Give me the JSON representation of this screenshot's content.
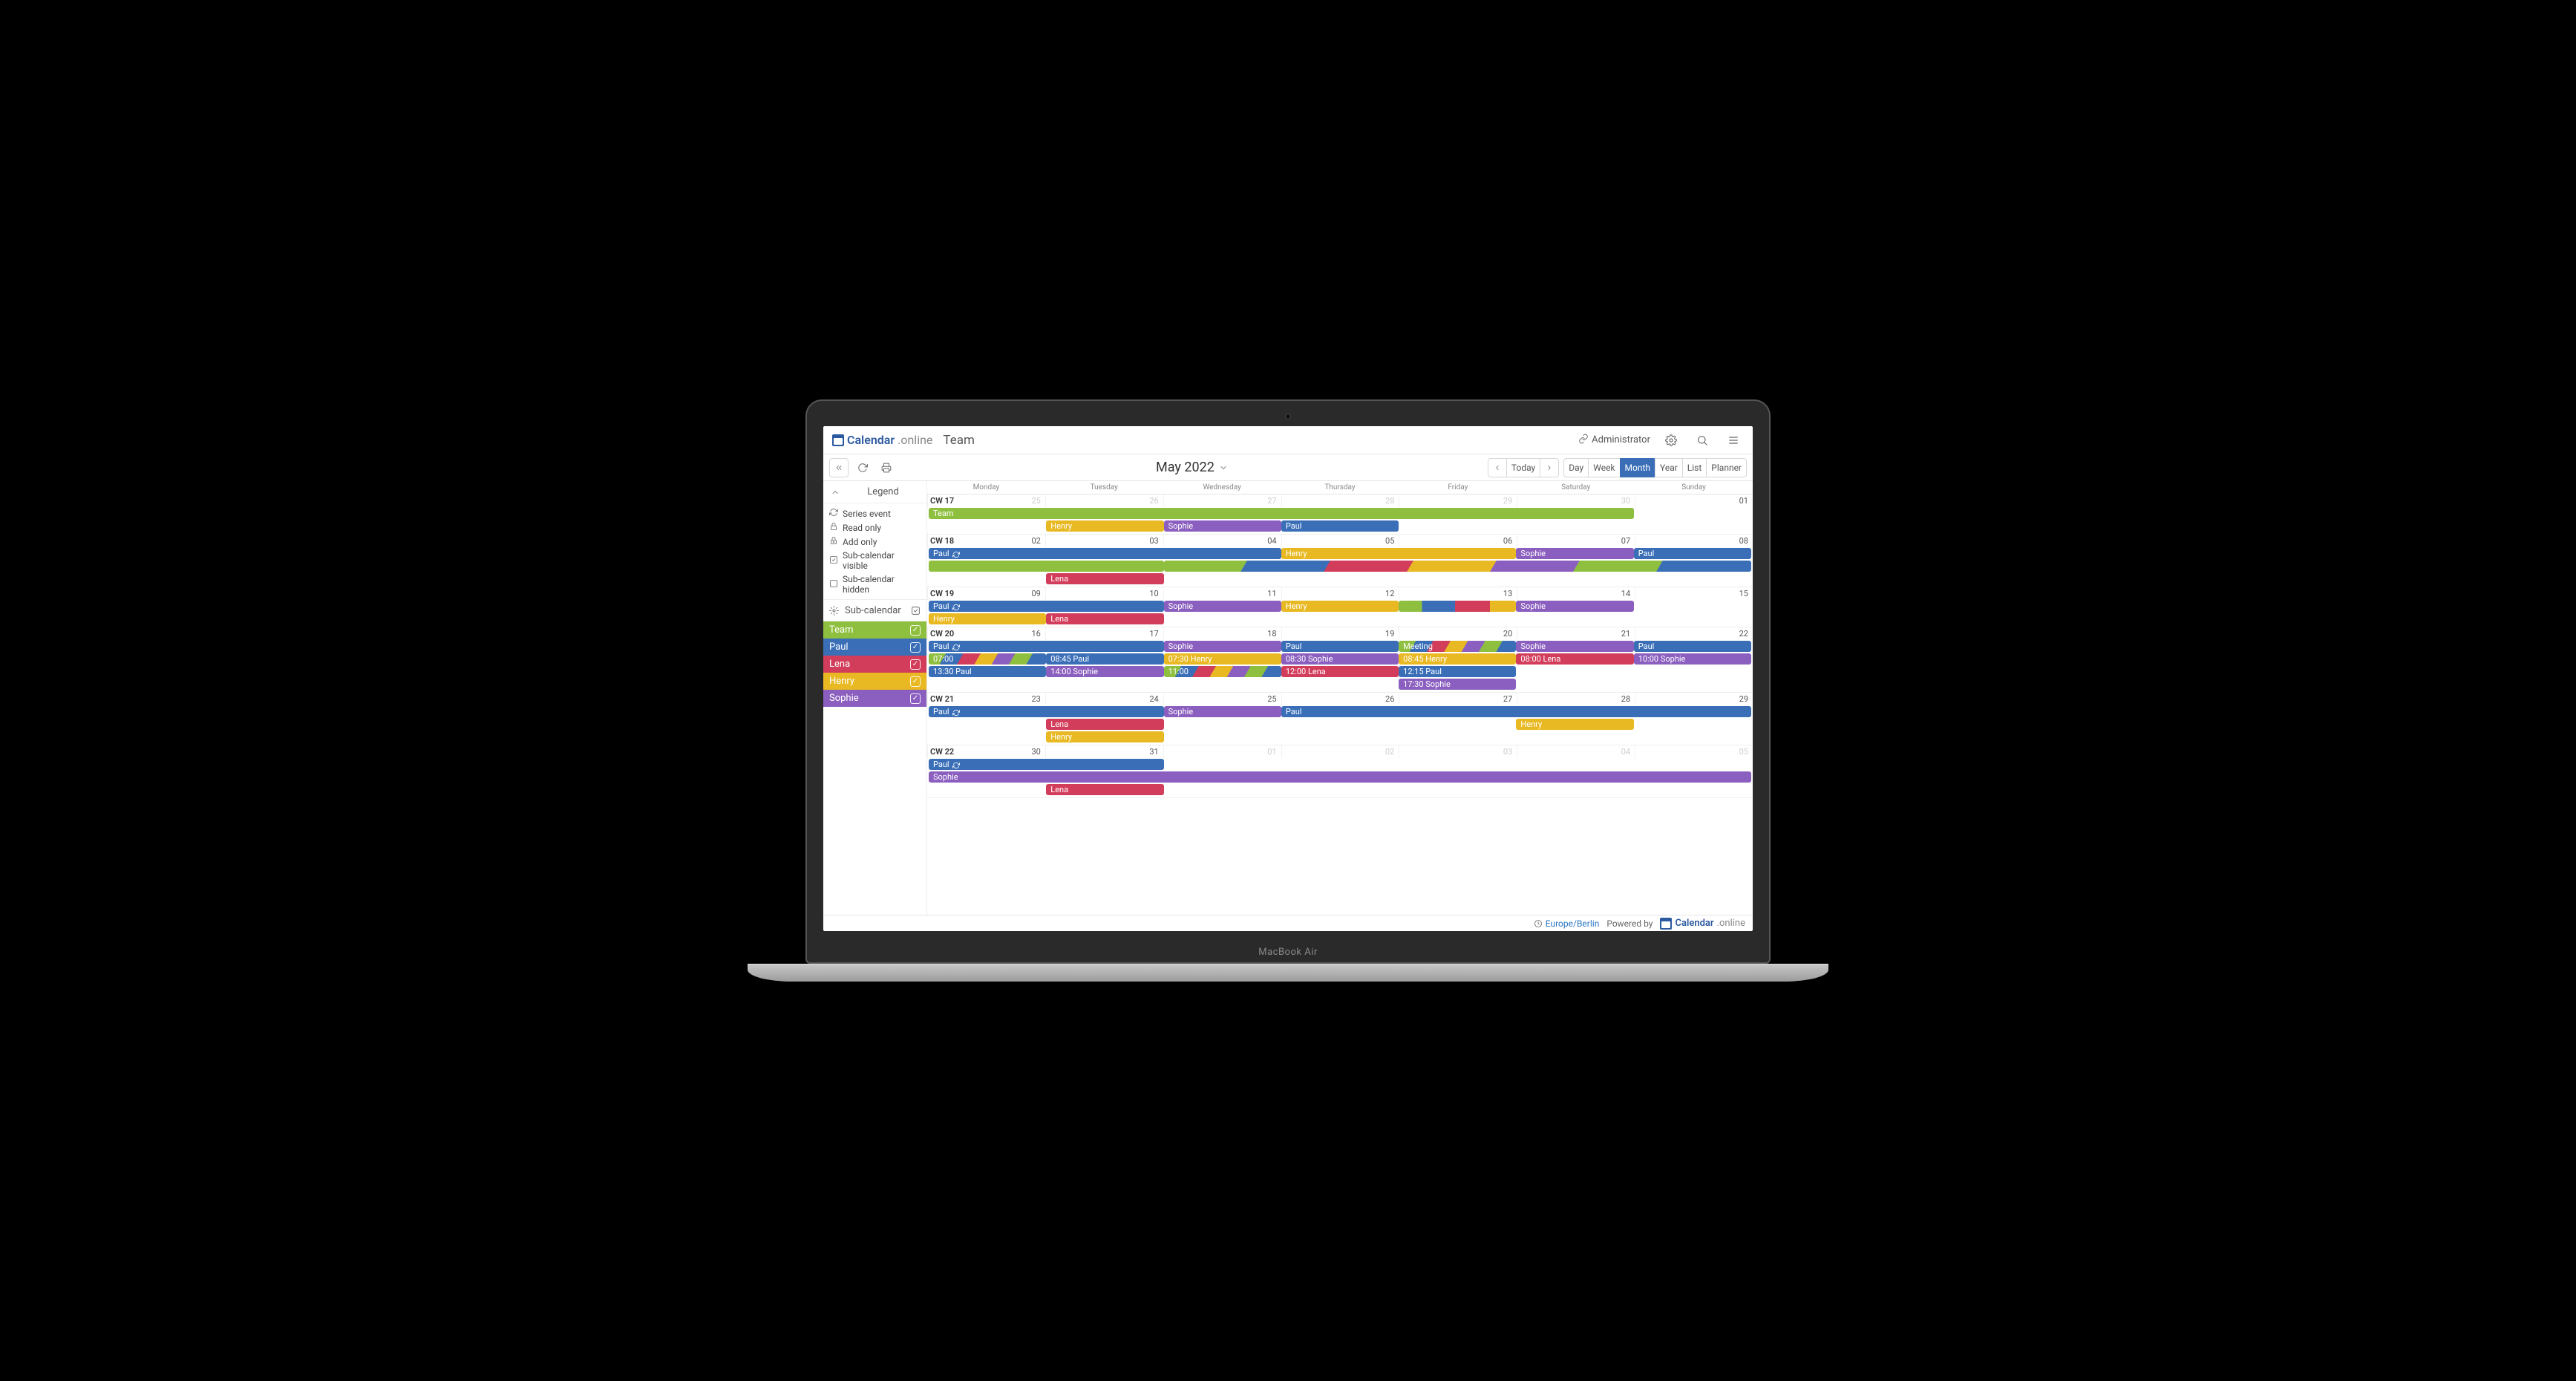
{
  "brand": {
    "part1": "Calendar",
    "part2": ".online"
  },
  "calendar_name": "Team",
  "admin_label": "Administrator",
  "toolbar": {
    "today": "Today",
    "day": "Day",
    "week": "Week",
    "month": "Month",
    "year": "Year",
    "list": "List",
    "planner": "Planner",
    "title": "May 2022"
  },
  "legend": {
    "title": "Legend",
    "items": [
      "Series event",
      "Read only",
      "Add only",
      "Sub-calendar visible",
      "Sub-calendar hidden"
    ]
  },
  "subcal": {
    "title": "Sub-calendar",
    "items": [
      {
        "label": "Team",
        "color": "#8fbf3f"
      },
      {
        "label": "Paul",
        "color": "#3a6fb8"
      },
      {
        "label": "Lena",
        "color": "#d23d5b"
      },
      {
        "label": "Henry",
        "color": "#e8b923"
      },
      {
        "label": "Sophie",
        "color": "#8b5fbf"
      }
    ]
  },
  "colors": {
    "team": "#8fbf3f",
    "paul": "#3a6fb8",
    "lena": "#d23d5b",
    "henry": "#e8b923",
    "sophie": "#8b5fbf"
  },
  "day_headers": [
    "Monday",
    "Tuesday",
    "Wednesday",
    "Thursday",
    "Friday",
    "Saturday",
    "Sunday"
  ],
  "weeks": [
    {
      "cw": "CW 17",
      "dates": [
        "25",
        "26",
        "27",
        "28",
        "29",
        "30",
        "01"
      ],
      "dim_until": 5,
      "rows": [
        [
          {
            "span": "1/7",
            "color": "team",
            "label": "Team"
          }
        ],
        [
          {
            "span": "2/3",
            "color": "henry",
            "label": "Henry"
          },
          {
            "span": "3/4",
            "color": "sophie",
            "label": "Sophie"
          },
          {
            "span": "4/5",
            "color": "paul",
            "label": "Paul"
          }
        ]
      ]
    },
    {
      "cw": "CW 18",
      "dates": [
        "02",
        "03",
        "04",
        "05",
        "06",
        "07",
        "08"
      ],
      "rows": [
        [
          {
            "span": "1/4",
            "color": "paul",
            "label": "Paul",
            "sync": true
          },
          {
            "span": "4/6",
            "color": "henry",
            "label": "Henry"
          },
          {
            "span": "6/7",
            "color": "sophie",
            "label": "Sophie"
          },
          {
            "span": "7/8",
            "color": "paul",
            "label": "Paul"
          }
        ],
        [
          {
            "span": "1/3",
            "color": "team",
            "label": "",
            "rright": false,
            "class": ""
          },
          {
            "span": "3/8",
            "class": "stripes",
            "label": ""
          }
        ],
        [
          {
            "span": "1/2",
            "class": "empty"
          },
          {
            "span": "2/3",
            "color": "lena",
            "label": "Lena"
          }
        ]
      ]
    },
    {
      "cw": "CW 19",
      "dates": [
        "09",
        "10",
        "11",
        "12",
        "13",
        "14",
        "15"
      ],
      "rows": [
        [
          {
            "span": "1/3",
            "color": "paul",
            "label": "Paul",
            "sync": true
          },
          {
            "span": "3/4",
            "color": "sophie",
            "label": "Sophie"
          },
          {
            "span": "4/5",
            "color": "henry",
            "label": "Henry"
          },
          {
            "span": "5/6",
            "class": "stripes2",
            "label": ""
          },
          {
            "span": "6/7",
            "color": "sophie",
            "label": "Sophie"
          }
        ],
        [
          {
            "span": "1/2",
            "color": "henry",
            "label": "Henry"
          },
          {
            "span": "2/3",
            "color": "lena",
            "label": "Lena"
          }
        ]
      ]
    },
    {
      "cw": "CW 20",
      "dates": [
        "16",
        "17",
        "18",
        "19",
        "20",
        "21",
        "22"
      ],
      "rows": [
        [
          {
            "span": "1/3",
            "color": "paul",
            "label": "Paul",
            "sync": true
          },
          {
            "span": "3/4",
            "color": "sophie",
            "label": "Sophie"
          },
          {
            "span": "4/5",
            "color": "paul",
            "label": "Paul"
          },
          {
            "span": "5/6",
            "class": "stripes",
            "label": "Meeting",
            "fg": "#fff"
          },
          {
            "span": "6/7",
            "color": "sophie",
            "label": "Sophie"
          },
          {
            "span": "7/8",
            "color": "paul",
            "label": "Paul"
          }
        ],
        [
          {
            "span": "1/2",
            "class": "stripes",
            "label": "07:00"
          },
          {
            "span": "2/3",
            "color": "paul",
            "label": "08:45 Paul"
          },
          {
            "span": "3/4",
            "color": "henry",
            "label": "07:30 Henry"
          },
          {
            "span": "4/5",
            "color": "sophie",
            "label": "08:30 Sophie"
          },
          {
            "span": "5/6",
            "color": "henry",
            "label": "08:45 Henry"
          },
          {
            "span": "6/7",
            "color": "lena",
            "label": "08:00 Lena"
          },
          {
            "span": "7/8",
            "color": "sophie",
            "label": "10:00 Sophie"
          }
        ],
        [
          {
            "span": "1/2",
            "color": "paul",
            "label": "13:30 Paul"
          },
          {
            "span": "2/3",
            "color": "sophie",
            "label": "14:00 Sophie"
          },
          {
            "span": "3/4",
            "class": "stripes",
            "label": "11:00"
          },
          {
            "span": "4/5",
            "color": "lena",
            "label": "12:00 Lena"
          },
          {
            "span": "5/6",
            "color": "paul",
            "label": "12:15 Paul"
          }
        ],
        [
          {
            "span": "5/6",
            "color": "sophie",
            "label": "17:30 Sophie"
          }
        ]
      ]
    },
    {
      "cw": "CW 21",
      "dates": [
        "23",
        "24",
        "25",
        "26",
        "27",
        "28",
        "29"
      ],
      "rows": [
        [
          {
            "span": "1/3",
            "color": "paul",
            "label": "Paul",
            "sync": true
          },
          {
            "span": "3/4",
            "color": "sophie",
            "label": "Sophie"
          },
          {
            "span": "4/8",
            "color": "paul",
            "label": "Paul"
          }
        ],
        [
          {
            "span": "2/3",
            "color": "lena",
            "label": "Lena"
          },
          {
            "span": "6/7",
            "color": "henry",
            "label": "Henry"
          }
        ],
        [
          {
            "span": "2/3",
            "color": "henry",
            "label": "Henry"
          }
        ]
      ]
    },
    {
      "cw": "CW 22",
      "dates": [
        "30",
        "31",
        "01",
        "02",
        "03",
        "04",
        "05"
      ],
      "dim_from": 2,
      "rows": [
        [
          {
            "span": "1/3",
            "color": "paul",
            "label": "Paul",
            "sync": true
          }
        ],
        [
          {
            "span": "1/8",
            "color": "sophie",
            "label": "Sophie"
          }
        ],
        [
          {
            "span": "2/3",
            "color": "lena",
            "label": "Lena"
          }
        ]
      ]
    }
  ],
  "footer": {
    "tz": "Europe/Berlin",
    "powered": "Powered by"
  },
  "laptop": "MacBook Air"
}
